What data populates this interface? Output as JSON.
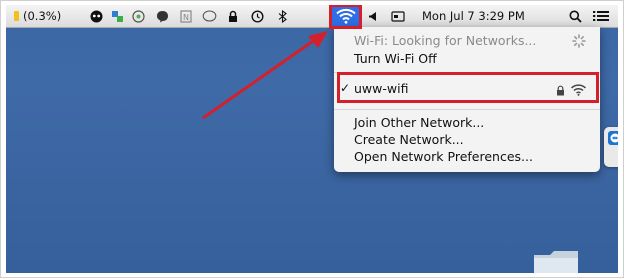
{
  "menubar": {
    "battery_percent": "(0.3%)",
    "clock": "Mon Jul 7  3:29 PM"
  },
  "wifi_menu": {
    "status": "Wi-Fi: Looking for Networks...",
    "toggle": "Turn Wi-Fi Off",
    "connected_network": "uww-wifi",
    "join_other": "Join Other Network...",
    "create": "Create Network...",
    "preferences": "Open Network Preferences..."
  },
  "colors": {
    "highlight": "#d4202a",
    "wifi_active_bg": "#2f6ee6",
    "desktop": "#3b67a6"
  }
}
